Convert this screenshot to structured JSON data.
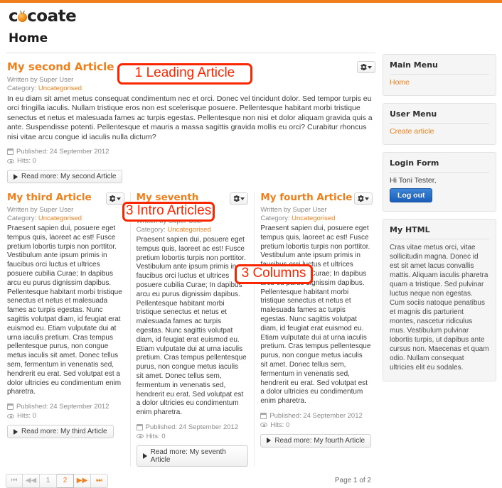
{
  "site": {
    "brand_prefix": "c",
    "brand_suffix": "coate",
    "page_title": "Home"
  },
  "leading": {
    "title": "My second Article",
    "author": "Written by Super User",
    "category_label": "Category:",
    "category": "Uncategorised",
    "body": "In eu diam sit amet metus consequat condimentum nec et orci. Donec vel tincidunt dolor. Sed tempor turpis eu orci fringilla iaculis. Nullam tristique eros non est scelerisque posuere. Pellentesque habitant morbi tristique senectus et netus et malesuada fames ac turpis egestas. Pellentesque non nisi et dolor aliquam gravida quis a ante. Suspendisse potenti. Pellentesque et mauris a massa sagittis gravida mollis eu orci? Curabitur rhoncus nisi vitae arcu congue id iaculis nulla dictum?",
    "published": "Published: 24 September 2012",
    "hits": "Hits: 0",
    "readmore": "Read more: My second Article"
  },
  "intro_body": "Praesent sapien dui, posuere eget tempus quis, laoreet ac est! Fusce pretium lobortis turpis non porttitor. Vestibulum ante ipsum primis in faucibus orci luctus et ultrices posuere cubilia Curae; In dapibus arcu eu purus dignissim dapibus. Pellentesque habitant morbi tristique senectus et netus et malesuada fames ac turpis egestas. Nunc sagittis volutpat diam, id feugiat erat euismod eu. Etiam vulputate dui at urna iaculis pretium. Cras tempus pellentesque purus, non congue metus iaculis sit amet. Donec tellus sem, fermentum in venenatis sed, hendrerit eu erat. Sed volutpat est a dolor ultricies eu condimentum enim pharetra.",
  "columns": [
    {
      "title": "My third Article",
      "author": "Written by Super User",
      "category_label": "Category:",
      "category": "Uncategorised",
      "published": "Published: 24 September 2012",
      "hits": "Hits: 0",
      "readmore": "Read more: My third Article"
    },
    {
      "title": "My seventh Article",
      "author": "Written by Super User",
      "category_label": "Category:",
      "category": "Uncategorised",
      "published": "Published: 24 September 2012",
      "hits": "Hits: 0",
      "readmore": "Read more: My seventh Article"
    },
    {
      "title": "My fourth Article",
      "author": "Written by Super User",
      "category_label": "Category:",
      "category": "Uncategorised",
      "published": "Published: 24 September 2012",
      "hits": "Hits: 0",
      "readmore": "Read more: My fourth Article"
    }
  ],
  "sidebar": {
    "main_menu": {
      "title": "Main Menu",
      "link": "Home"
    },
    "user_menu": {
      "title": "User Menu",
      "link": "Create article"
    },
    "login_form": {
      "title": "Login Form",
      "greeting": "Hi Toni Tester,",
      "logout": "Log out"
    },
    "my_html": {
      "title": "My HTML",
      "body": "Cras vitae metus orci, vitae sollicitudin magna. Donec id est sit amet lacus convallis mattis. Aliquam iaculis pharetra quam a tristique. Sed pulvinar luctus neque non egestas. Cum sociis natoque penatibus et magnis dis parturient montes, nascetur ridiculus mus. Vestibulum pulvinar lobortis turpis, ut dapibus ante cursus non. Maecenas et quam odio. Nullam consequat ultricies elit eu sodales."
    }
  },
  "pagination": {
    "first": "⏮",
    "prev": "◀◀",
    "page1": "1",
    "page2": "2",
    "next": "▶▶",
    "last": "⏭",
    "page_count": "Page 1 of 2"
  },
  "annotations": {
    "leading": "1 Leading Article",
    "intro": "3 Intro Articles",
    "columns": "3 Columns"
  },
  "colors": {
    "accent": "#ee7f1b",
    "annotation": "#fa2600",
    "button_blue": "#1b5fbb"
  }
}
